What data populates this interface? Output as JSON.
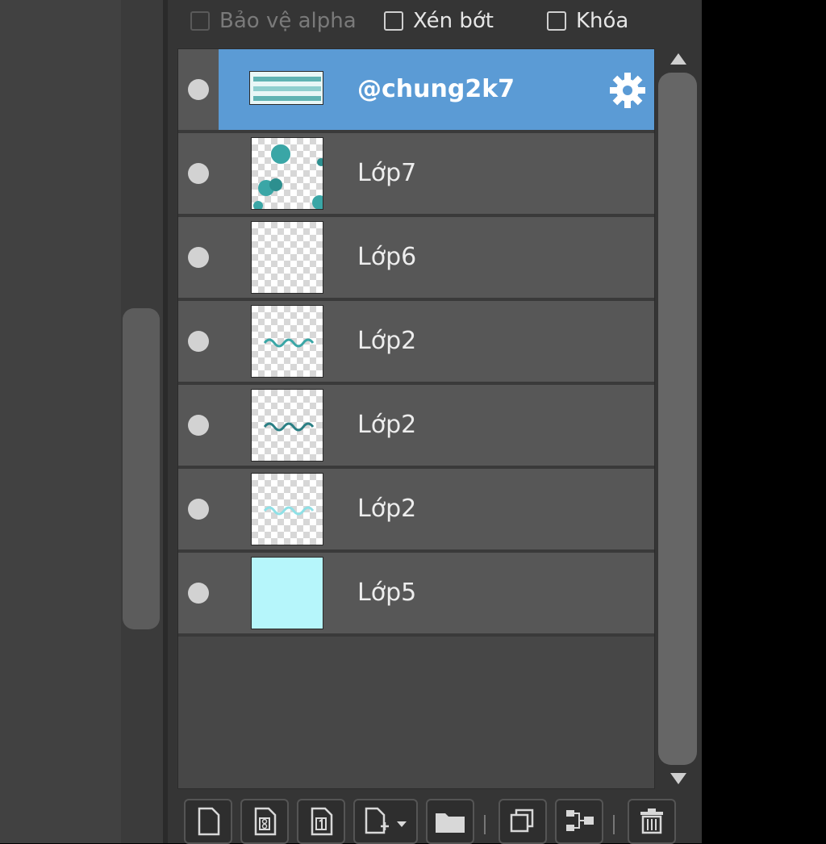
{
  "layer_options": {
    "protect_alpha": "Bảo vệ alpha",
    "clipping": "Xén bớt",
    "lock": "Khóa"
  },
  "layers": [
    {
      "name": "@chung2k7",
      "selected": true
    },
    {
      "name": "Lớp7"
    },
    {
      "name": "Lớp6"
    },
    {
      "name": "Lớp2"
    },
    {
      "name": "Lớp2"
    },
    {
      "name": "Lớp2"
    },
    {
      "name": "Lớp5"
    }
  ],
  "colors": {
    "selection": "#5b9bd5",
    "row": "#575757",
    "teal_paint": "#3aa6a6",
    "fill_color": "#b6f6fb"
  },
  "toolbar": {
    "buttons": [
      "new-layer-icon",
      "new-8bit-layer-icon",
      "new-1bit-layer-icon",
      "add-layer-menu-icon",
      "new-folder-icon",
      "duplicate-layer-icon",
      "merge-down-icon",
      "delete-layer-icon"
    ]
  }
}
